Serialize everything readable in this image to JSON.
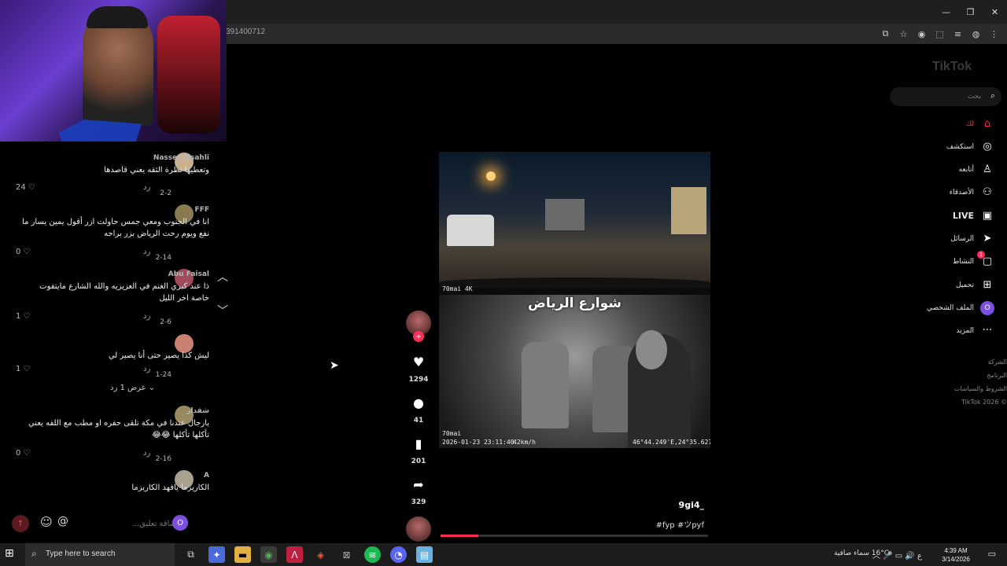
{
  "browser": {
    "url_fragment": "391400712",
    "window_controls": [
      "—",
      "❐",
      "✕"
    ],
    "address_icons": [
      "⧉",
      "☆",
      "◉",
      "⬚",
      "≡",
      "◍",
      "⋮"
    ]
  },
  "comments": [
    {
      "author": "Nasser alsahli",
      "text": "وتعطيها نظرة الثقه يعني قاصدها",
      "date": "2-2",
      "reply": "رد",
      "likes": "24"
    },
    {
      "author": "FFF",
      "text": "انا في الجنوب ومعي جمس حاولت ازر أقول يمين يسار ما نفع ويوم رحت الرياض بزر براحه",
      "date": "2-14",
      "reply": "رد",
      "likes": "0"
    },
    {
      "author": "Abu Faisal",
      "text": "ذا عند كبري الغنم في العزيزيه والله الشارع مايتفوت خاصة اخر الليل",
      "date": "2-6",
      "reply": "رد",
      "likes": "1"
    },
    {
      "author": "",
      "text": "ليش كذا يصير حتى أنا يصير لي",
      "date": "1-24",
      "reply": "رد",
      "likes": "1"
    },
    {
      "author": "شقدار",
      "text": "يارجال عندنا في مكة تلقى حفره او مطب مع اللفه يعني تأكلها تأكلها 😂😂",
      "date": "2-16",
      "reply": "رد",
      "likes": "0"
    },
    {
      "author": "A",
      "text": "الكاريزما يافهد الكاريزما",
      "date": "",
      "reply": "",
      "likes": ""
    }
  ],
  "show_replies": "عرض 1 رد",
  "comment_input": {
    "placeholder": "إضافة تعليق...",
    "at": "@",
    "emoji": "☺",
    "me": "O"
  },
  "video": {
    "caption": "شوارع الرياض",
    "brand_top": "70mai 4K",
    "brand_bottom": "70mai",
    "timestamp": "2026-01-23 23:11:40",
    "speed": "42km/h",
    "coords": "46°44.249'E,24°35.627'N",
    "progress": 0.14
  },
  "author": "9gi4_",
  "description": "#fyp #ツpyf",
  "actions": {
    "likes": "1294",
    "comments": "41",
    "saves": "201",
    "shares": "329"
  },
  "tiktok": {
    "logo": "TikTok",
    "search_placeholder": "بحث",
    "nav": [
      {
        "label": "لك",
        "icon": "⌂",
        "active": true
      },
      {
        "label": "استكشف",
        "icon": "◎",
        "active": false
      },
      {
        "label": "أتابعه",
        "icon": "♙",
        "active": false
      },
      {
        "label": "الأصدقاء",
        "icon": "⚇",
        "active": false
      },
      {
        "label": "LIVE",
        "icon": "▣",
        "active": false
      },
      {
        "label": "الرسائل",
        "icon": "➤",
        "active": false
      },
      {
        "label": "النشاط",
        "icon": "▢",
        "active": false,
        "badge": "1"
      },
      {
        "label": "تحميل",
        "icon": "⊞",
        "active": false
      },
      {
        "label": "الملف الشخصي",
        "icon": "O",
        "active": false
      },
      {
        "label": "المزيد",
        "icon": "···",
        "active": false
      }
    ],
    "footer": [
      "الشركة",
      "البرنامج",
      "الشروط والسياسات",
      "© TikTok 2026"
    ]
  },
  "taskbar": {
    "search": "Type here to search",
    "weather": "16°C  سماء صافية",
    "lang": "ع",
    "time": "4:39 AM",
    "date": "3/14/2026"
  },
  "colors": {
    "accent": "#fe2c55",
    "profile": "#7b4fe0"
  }
}
